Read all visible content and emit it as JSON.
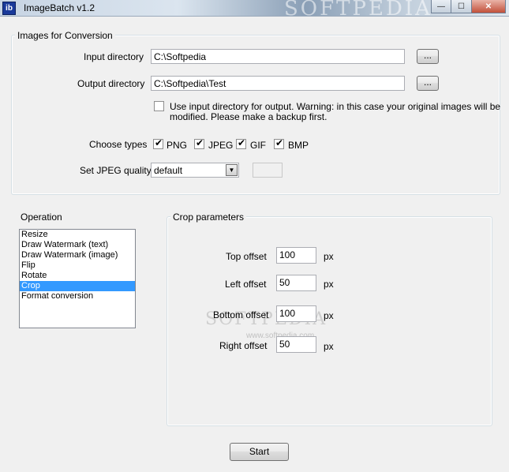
{
  "window": {
    "title": "ImageBatch v1.2",
    "icon_text": "ib",
    "watermark": "SOFTPEDIA",
    "min": "—",
    "max": "☐",
    "close": "✕"
  },
  "images_group": {
    "title": "Images for Conversion",
    "input_label": "Input directory",
    "input_value": "C:\\Softpedia",
    "output_label": "Output directory",
    "output_value": "C:\\Softpedia\\Test",
    "browse_label": "...",
    "use_input_line1": "Use input directory for output. Warning: in this case your original images will be",
    "use_input_line2": "modified. Please make a backup first.",
    "use_input_checked": false,
    "choose_types_label": "Choose types",
    "types": [
      {
        "label": "PNG",
        "checked": true
      },
      {
        "label": "JPEG",
        "checked": true
      },
      {
        "label": "GIF",
        "checked": true
      },
      {
        "label": "BMP",
        "checked": true
      }
    ],
    "jpeg_quality_label": "Set JPEG quality",
    "jpeg_quality_value": "default"
  },
  "operation": {
    "label": "Operation",
    "items": [
      "Resize",
      "Draw Watermark (text)",
      "Draw Watermark (image)",
      "Flip",
      "Rotate",
      "Crop",
      "Format conversion"
    ],
    "selected": "Crop"
  },
  "crop": {
    "title": "Crop parameters",
    "unit": "px",
    "top_label": "Top offset",
    "top_value": "100",
    "left_label": "Left offset",
    "left_value": "50",
    "bottom_label": "Bottom offset",
    "bottom_value": "100",
    "right_label": "Right offset",
    "right_value": "50",
    "watermark": "SOFTPEDIA",
    "watermark_url": "www.softpedia.com"
  },
  "start_label": "Start"
}
